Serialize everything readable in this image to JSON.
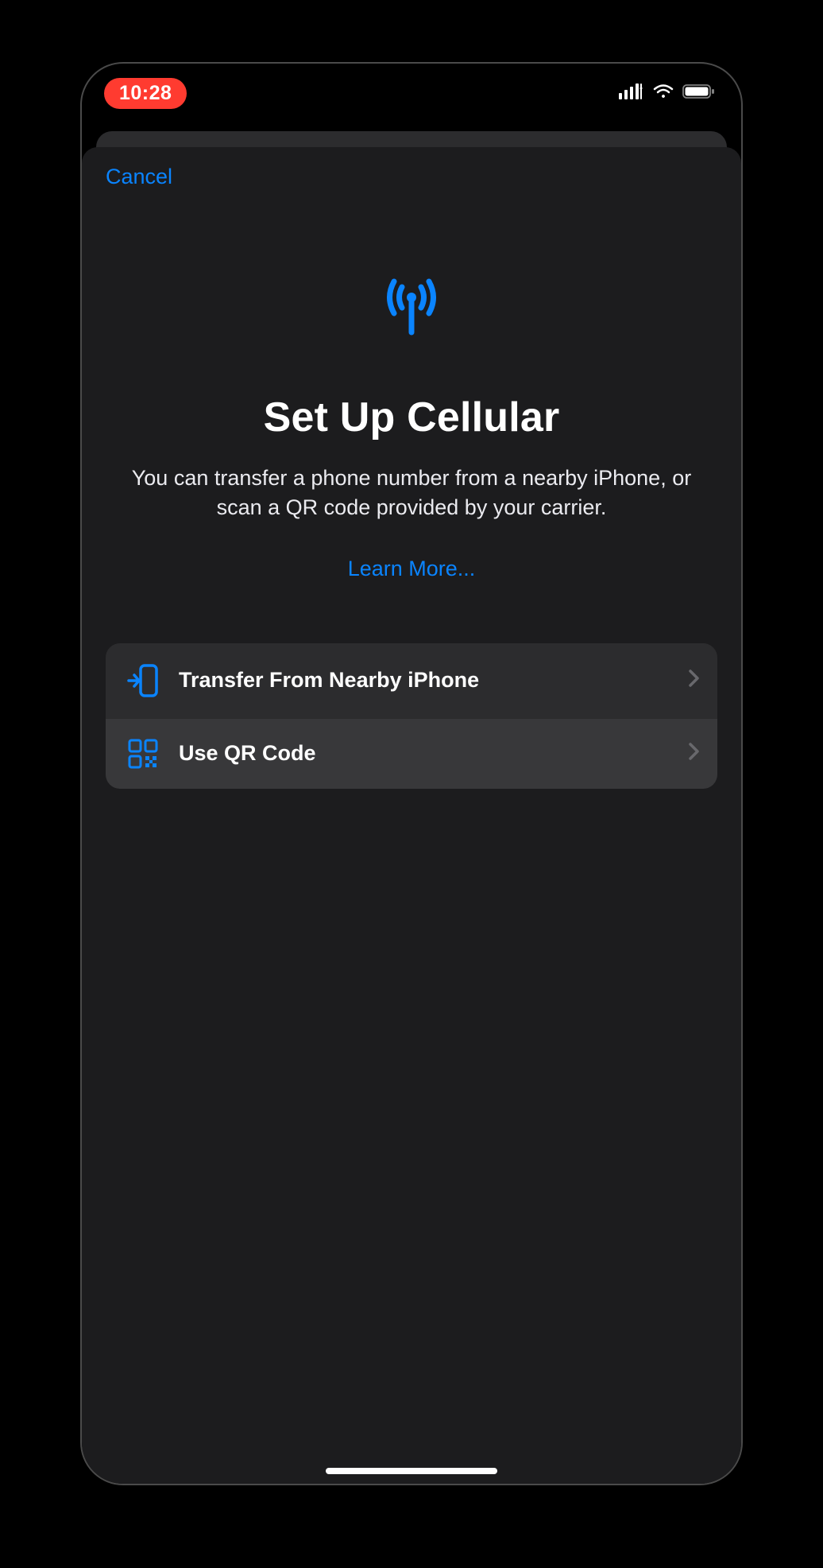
{
  "status": {
    "time": "10:28"
  },
  "sheet": {
    "cancel_label": "Cancel",
    "title": "Set Up Cellular",
    "description": "You can transfer a phone number from a nearby iPhone, or scan a QR code provided by your carrier.",
    "learn_more_label": "Learn More...",
    "actions": [
      {
        "label": "Transfer From Nearby iPhone",
        "icon": "transfer-phone-icon"
      },
      {
        "label": "Use QR Code",
        "icon": "qr-code-icon"
      }
    ]
  }
}
